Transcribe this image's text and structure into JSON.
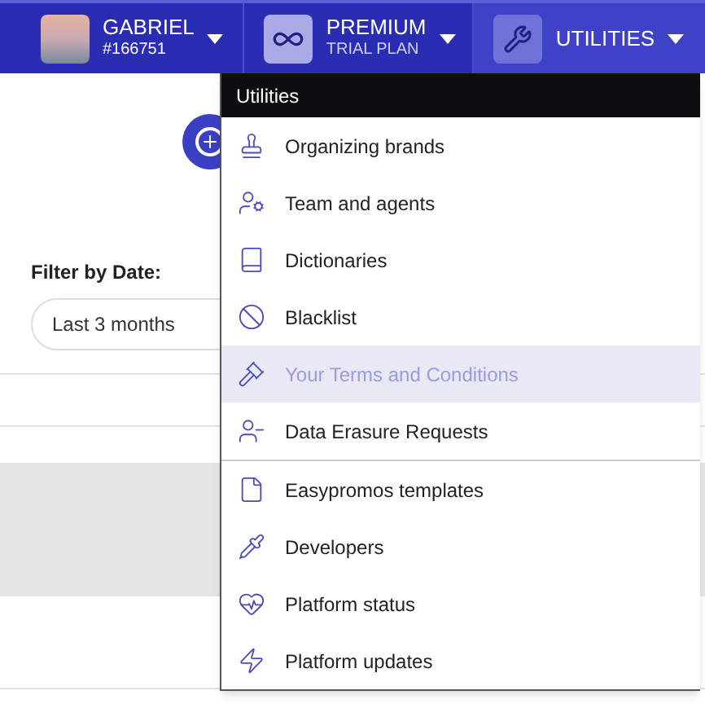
{
  "nav": {
    "account": {
      "name": "GABRIEL",
      "id": "#166751"
    },
    "plan": {
      "name": "PREMIUM",
      "subtitle": "TRIAL PLAN"
    },
    "utilities": {
      "label": "UTILITIES",
      "open": true
    }
  },
  "filter": {
    "label": "Filter by Date:",
    "value": "Last 3 months"
  },
  "menu": {
    "title": "Utilities",
    "groups": [
      [
        {
          "label": "Organizing brands",
          "highlighted": false
        },
        {
          "label": "Team and agents",
          "highlighted": false
        },
        {
          "label": "Dictionaries",
          "highlighted": false
        },
        {
          "label": "Blacklist",
          "highlighted": false
        },
        {
          "label": "Your Terms and Conditions",
          "highlighted": true
        },
        {
          "label": "Data Erasure Requests",
          "highlighted": false
        }
      ],
      [
        {
          "label": "Easypromos templates",
          "highlighted": false
        },
        {
          "label": "Developers",
          "highlighted": false
        },
        {
          "label": "Platform status",
          "highlighted": false
        },
        {
          "label": "Platform updates",
          "highlighted": false
        }
      ]
    ]
  }
}
